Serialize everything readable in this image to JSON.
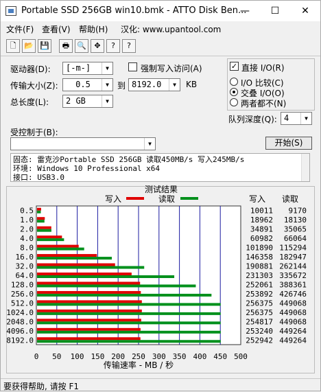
{
  "window": {
    "title": "Portable SSD 256GB win10.bmk - ATTO Disk Ben...",
    "min": "—",
    "max": "☐",
    "close": "✕"
  },
  "menu": {
    "file": "文件(F)",
    "view": "查看(V)",
    "help": "帮助(H)",
    "credit": "汉化: www.upantool.com"
  },
  "toolbar": [
    {
      "name": "new-icon",
      "glyph": "🗋"
    },
    {
      "name": "open-icon",
      "glyph": "📂"
    },
    {
      "name": "save-icon",
      "glyph": "💾"
    },
    {
      "name": "print-icon",
      "glyph": "🖶"
    },
    {
      "name": "print-preview-icon",
      "glyph": "🔍"
    },
    {
      "name": "move-icon",
      "glyph": "✥"
    },
    {
      "name": "help-icon",
      "glyph": "?"
    },
    {
      "name": "context-help-icon",
      "glyph": "?"
    }
  ],
  "form": {
    "drive_label": "驱动器(D):",
    "drive_value": "[-m-]",
    "transfer_label": "传输大小(Z):",
    "transfer_from": "0.5",
    "transfer_to_label": "到",
    "transfer_to": "8192.0",
    "transfer_unit": "KB",
    "length_label": "总长度(L):",
    "length_value": "2 GB",
    "force_write_label": "强制写入访问(A)",
    "direct_io_label": "直接 I/O(R)",
    "direct_io_checked": true,
    "io_compare_label": "I/O 比较(C)",
    "overlap_io_label": "交叠 I/O(O)",
    "neither_label": "两者都不(N)",
    "selected_io_mode": "overlap",
    "queue_label": "队列深度(Q):",
    "queue_value": "4",
    "controlled_by_label": "受控制于(B):",
    "controlled_by_value": "",
    "start_button": "开始(S)"
  },
  "info": {
    "line1": "固态: 雷克沙Portable SSD 256GB 读取450MB/s 写入245MB/s",
    "line2": "环境: Windows 10 Professional x64",
    "line3": "接口: USB3.0"
  },
  "chart_data": {
    "type": "bar",
    "title": "测试结果",
    "xlabel": "传输速率 - MB / 秒",
    "xlim": [
      0,
      500
    ],
    "xticks": [
      "0",
      "50",
      "100",
      "150",
      "200",
      "250",
      "300",
      "350",
      "400",
      "450",
      "500"
    ],
    "categories": [
      "0.5",
      "1.0",
      "2.0",
      "4.0",
      "8.0",
      "16.0",
      "32.0",
      "64.0",
      "128.0",
      "256.0",
      "512.0",
      "1024.0",
      "2048.0",
      "4096.0",
      "8192.0"
    ],
    "series": [
      {
        "name": "写入",
        "color": "#e00000",
        "values": [
          10011,
          18962,
          34891,
          60982,
          101890,
          146358,
          190881,
          231303,
          252061,
          253892,
          256375,
          256375,
          254817,
          253240,
          252942
        ]
      },
      {
        "name": "读取",
        "color": "#00901c",
        "values": [
          9170,
          18130,
          35065,
          66064,
          115294,
          182947,
          262144,
          335672,
          388361,
          426746,
          449068,
          449068,
          449068,
          449264,
          449264
        ]
      }
    ],
    "table_headers": [
      "写入",
      "读取"
    ],
    "value_scale_note_kb_per_mb": 1000,
    "grid": true,
    "legend": "top"
  },
  "status": {
    "text": "要获得帮助, 请按 F1"
  }
}
